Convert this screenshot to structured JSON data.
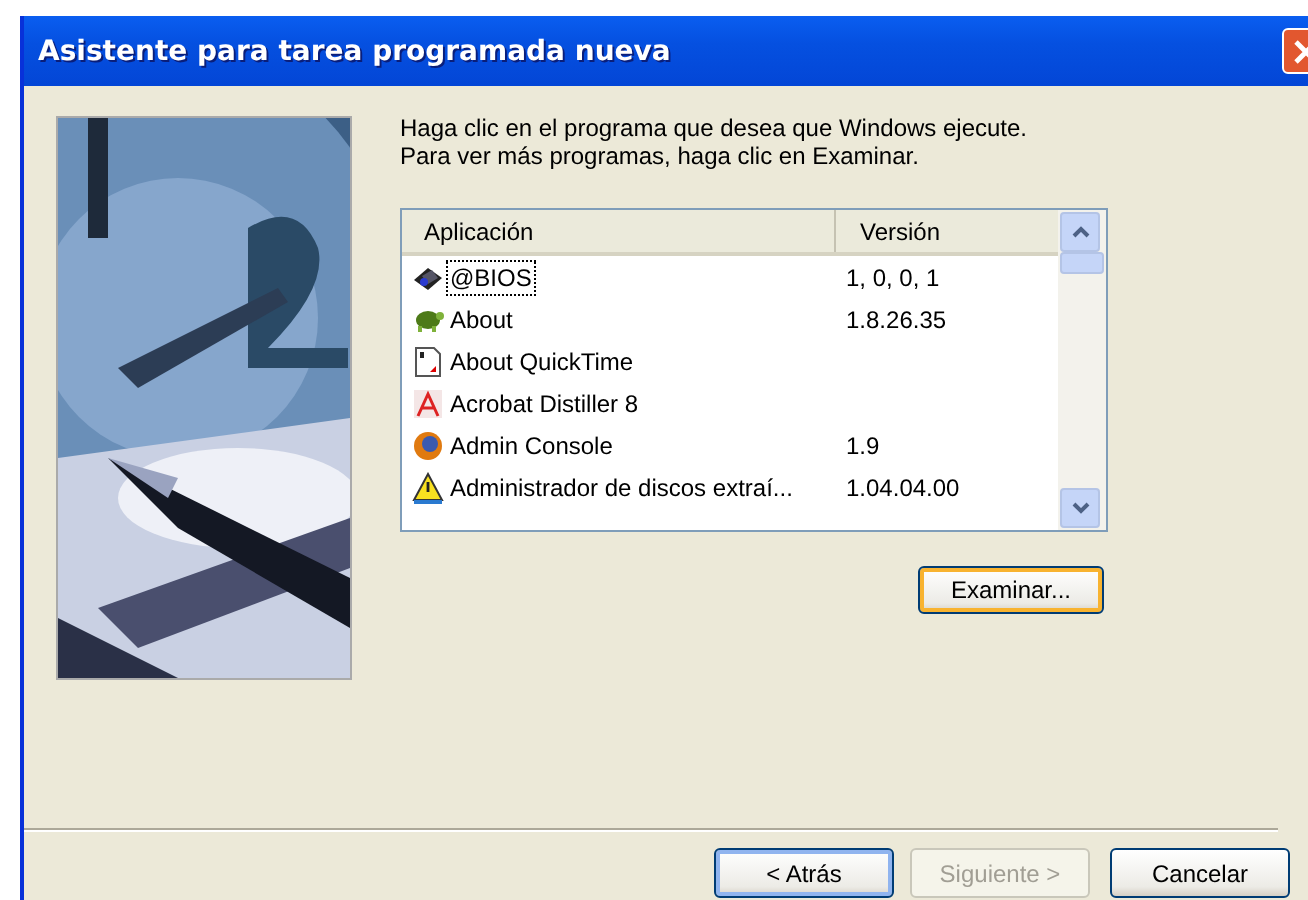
{
  "window": {
    "title": "Asistente para tarea programada nueva"
  },
  "instructions": [
    "Haga clic en el programa que desea que Windows ejecute.",
    "Para ver más programas, haga clic en Examinar."
  ],
  "table": {
    "columns": [
      "Aplicación",
      "Versión"
    ],
    "rows": [
      {
        "name": "@BIOS",
        "version": "1, 0, 0, 1",
        "focused": true
      },
      {
        "name": "About",
        "version": "1.8.26.35",
        "focused": false
      },
      {
        "name": "About QuickTime",
        "version": "",
        "focused": false
      },
      {
        "name": "Acrobat Distiller 8",
        "version": "",
        "focused": false
      },
      {
        "name": "Admin Console",
        "version": "1.9",
        "focused": false
      },
      {
        "name": "Administrador de discos extraí...",
        "version": "1.04.04.00",
        "focused": false
      }
    ]
  },
  "browse_button": "Examinar...",
  "buttons": [
    {
      "label": "< Atrás",
      "disabled": false,
      "default": true
    },
    {
      "label": "Siguiente >",
      "disabled": true,
      "default": false
    },
    {
      "label": "Cancelar",
      "disabled": false,
      "default": false
    }
  ]
}
